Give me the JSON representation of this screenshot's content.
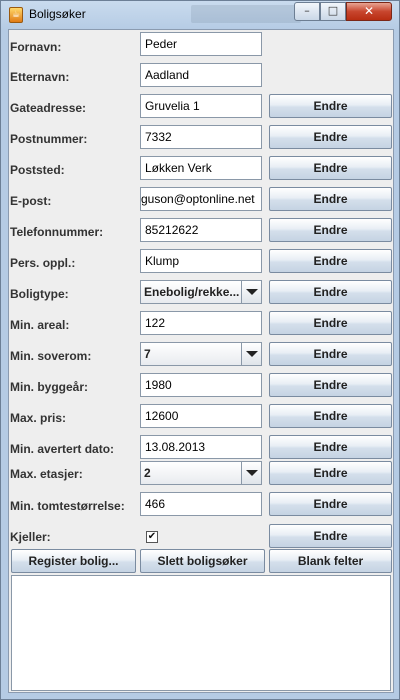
{
  "window": {
    "title": "Boligsøker",
    "minimize_glyph": "–",
    "maximize_glyph": "□",
    "close_glyph": "✕",
    "icon": "java-icon"
  },
  "fields": [
    {
      "label": "Fornavn:",
      "value": "Peder"
    },
    {
      "label": "Etternavn:",
      "value": "Aadland"
    },
    {
      "label": "Gateadresse:",
      "value": "Gruvelia 1"
    },
    {
      "label": "Postnummer:",
      "value": "7332"
    },
    {
      "label": "Poststed:",
      "value": "Løkken Verk"
    },
    {
      "label": "E-post:",
      "value": "guson@optonline.net"
    },
    {
      "label": "Telefonnummer:",
      "value": "85212622"
    },
    {
      "label": "Pers. oppl.:",
      "value": "Klump"
    },
    {
      "label": "Boligtype:",
      "value": "Enebolig/rekke..."
    },
    {
      "label": "Min. areal:",
      "value": "122"
    },
    {
      "label": "Min. soverom:",
      "value": "7"
    },
    {
      "label": "Min. byggeår:",
      "value": "1980"
    },
    {
      "label": "Max. pris:",
      "value": "12600"
    },
    {
      "label": "Min. avertert dato:",
      "value": "13.08.2013"
    },
    {
      "label": "Max. etasjer:",
      "value": "2"
    },
    {
      "label": "Min. tomtestørrelse:",
      "value": "466"
    },
    {
      "label": "Kjeller:",
      "value": "✔"
    }
  ],
  "endre_label": "Endre",
  "actions": {
    "register": "Register bolig...",
    "delete": "Slett boligsøker",
    "clear": "Blank felter"
  }
}
